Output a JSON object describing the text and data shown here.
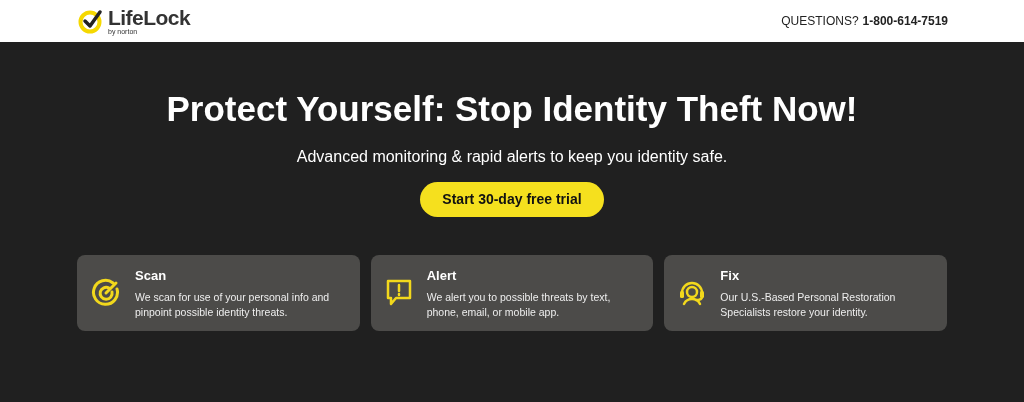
{
  "header": {
    "logo": {
      "name": "LifeLock",
      "tagline": "by norton"
    },
    "contact": {
      "label": "QUESTIONS?",
      "phone": "1-800-614-7519"
    }
  },
  "hero": {
    "title": "Protect Yourself: Stop Identity Theft Now!",
    "subtitle": "Advanced monitoring & rapid alerts to keep you identity safe.",
    "cta": "Start 30-day free trial"
  },
  "features": [
    {
      "kind": "scan",
      "title": "Scan",
      "text": "We scan for use of your personal info and pinpoint possible identity threats."
    },
    {
      "kind": "alert",
      "title": "Alert",
      "text": "We alert you to possible threats by text, phone, email, or mobile app."
    },
    {
      "kind": "fix",
      "title": "Fix",
      "text": "Our U.S.-Based Personal Restoration Specialists restore your identity."
    }
  ]
}
